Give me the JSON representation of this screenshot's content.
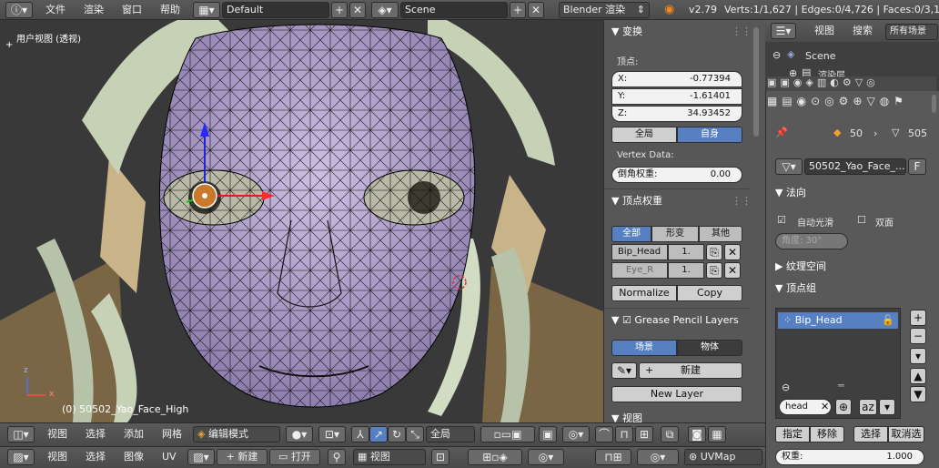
{
  "top": {
    "menus": [
      "文件",
      "渲染",
      "窗口",
      "帮助"
    ],
    "layout": "Default",
    "scene": "Scene",
    "engine": "Blender 渲染",
    "version": "v2.79",
    "stats": "Verts:1/1,627 | Edges:0/4,726 | Faces:0/3,10"
  },
  "viewport": {
    "view_label": "用户视图 (透视)",
    "object_label": "(0) 50502_Yao_Face_High",
    "axis_z": "z",
    "axis_x": "x"
  },
  "transform": {
    "header": "变换",
    "vertex_label": "顶点:",
    "x": "X:",
    "x_val": "-0.77394",
    "y": "Y:",
    "y_val": "-1.61401",
    "z": "Z:",
    "z_val": "34.93452",
    "global": "全局",
    "local": "自身",
    "vertex_data": "Vertex Data:",
    "bevel_label": "倒角权重:",
    "bevel_val": "0.00"
  },
  "vweights": {
    "header": "顶点权重",
    "tabs": [
      "全部",
      "形变",
      "其他"
    ],
    "groups": [
      {
        "name": "Bip_Head",
        "val": "1."
      },
      {
        "name": "Eye_R",
        "val": "1."
      }
    ],
    "normalize": "Normalize",
    "copy": "Copy"
  },
  "gpencil": {
    "header": "Grease Pencil Layers",
    "scene": "场景",
    "object": "物体",
    "new": "新建",
    "new_layer": "New Layer"
  },
  "view_header": "视图",
  "bottom1": {
    "menus": [
      "视图",
      "选择",
      "添加",
      "网格"
    ],
    "mode": "编辑模式",
    "orient": "全局"
  },
  "bottom2": {
    "menus": [
      "视图",
      "选择",
      "图像",
      "UV"
    ],
    "new": "新建",
    "open": "打开",
    "view": "视图",
    "uvmap": "UVMap"
  },
  "outliner": {
    "view": "视图",
    "search": "搜索",
    "all_scenes": "所有场景",
    "scene": "Scene",
    "render_layer": "渲染层"
  },
  "props": {
    "count_50": "50",
    "count_505": "505",
    "mesh_name": "50502_Yao_Face_...",
    "f": "F",
    "normals": "法向",
    "auto_smooth": "自动光滑",
    "double_sided": "双面",
    "angle": "角度: 30°",
    "texture_space": "纹理空间",
    "vertex_groups": "顶点组",
    "group_item": "Bip_Head",
    "filter_val": "head",
    "assign": "指定",
    "remove": "移除",
    "select": "选择",
    "deselect": "取消选",
    "weight_label": "权重:",
    "weight_val": "1.000"
  },
  "colors": {
    "accent": "#5680c2",
    "face": "#b9a8d4",
    "hair": "#c8d4b8"
  }
}
